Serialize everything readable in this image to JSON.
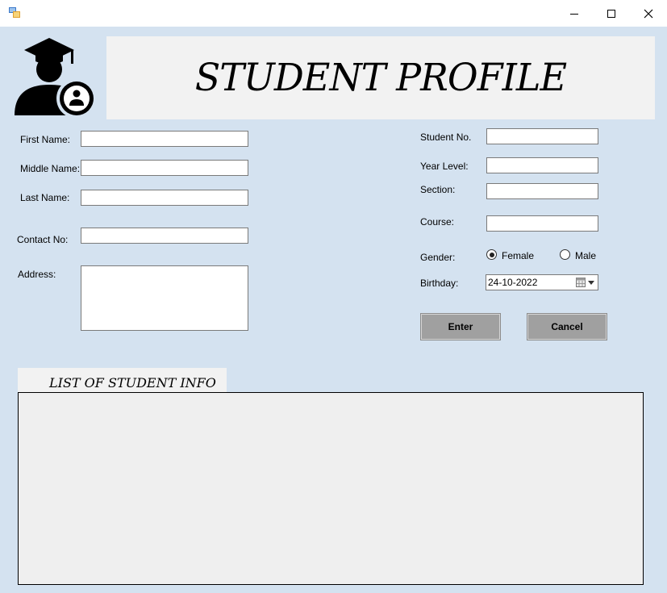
{
  "window": {
    "title": "",
    "controls": {
      "minimize": "minimize-icon",
      "maximize": "maximize-icon",
      "close": "close-icon"
    }
  },
  "header": {
    "title": "STUDENT PROFILE",
    "logo_icon": "student-graduate-icon"
  },
  "form_left": {
    "first_name": {
      "label": "First Name:",
      "value": ""
    },
    "middle_name": {
      "label": "Middle Name:",
      "value": ""
    },
    "last_name": {
      "label": "Last Name:",
      "value": ""
    },
    "contact_no": {
      "label": "Contact No:",
      "value": ""
    },
    "address": {
      "label": "Address:",
      "value": ""
    }
  },
  "form_right": {
    "student_no": {
      "label": "Student No.",
      "value": ""
    },
    "year_level": {
      "label": "Year Level:",
      "value": ""
    },
    "section": {
      "label": "Section:",
      "value": ""
    },
    "course": {
      "label": "Course:",
      "value": ""
    },
    "gender": {
      "label": "Gender:",
      "options": [
        "Female",
        "Male"
      ],
      "selected": "Female"
    },
    "birthday": {
      "label": "Birthday:",
      "value": "24-10-2022"
    }
  },
  "buttons": {
    "enter": "Enter",
    "cancel": "Cancel"
  },
  "list": {
    "title": "LIST OF STUDENT INFO"
  },
  "colors": {
    "background": "#d4e2f0",
    "banner": "#f2f2f2",
    "button": "#a0a0a0",
    "list_panel": "#efefef"
  }
}
